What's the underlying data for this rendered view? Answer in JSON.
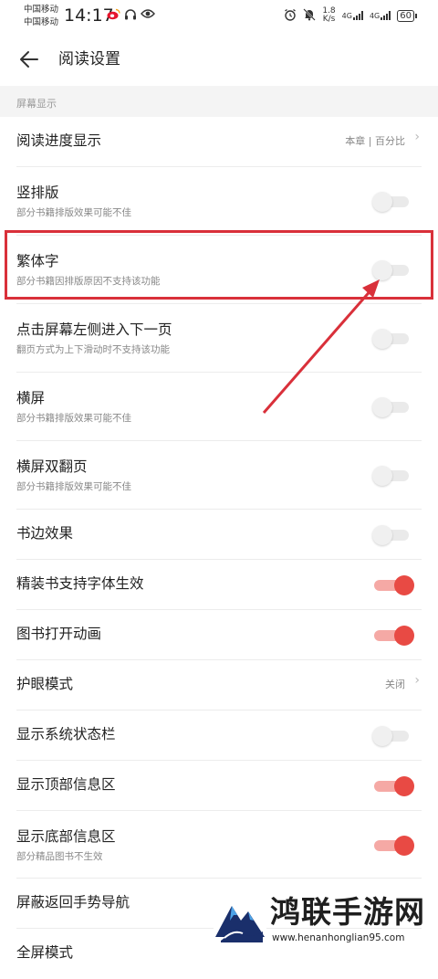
{
  "status_bar": {
    "carrier_1": "中国移动",
    "carrier_2": "中国移动",
    "time": "14:17",
    "net_speed_value": "1.8",
    "net_speed_unit": "K/s",
    "signal_1": "4G",
    "signal_2": "4G",
    "battery": "60"
  },
  "header": {
    "title": "阅读设置"
  },
  "section": {
    "title": "屏幕显示"
  },
  "rows": [
    {
      "title": "阅读进度显示",
      "value": "本章 | 百分比"
    },
    {
      "title": "竖排版",
      "subtitle": "部分书籍排版效果可能不佳",
      "toggle_on": false
    },
    {
      "title": "繁体字",
      "subtitle": "部分书籍因排版原因不支持该功能",
      "toggle_on": false
    },
    {
      "title": "点击屏幕左侧进入下一页",
      "subtitle": "翻页方式为上下滑动时不支持该功能",
      "toggle_on": false
    },
    {
      "title": "横屏",
      "subtitle": "部分书籍排版效果可能不佳",
      "toggle_on": false
    },
    {
      "title": "横屏双翻页",
      "subtitle": "部分书籍排版效果可能不佳",
      "toggle_on": false
    },
    {
      "title": "书边效果",
      "toggle_on": false
    },
    {
      "title": "精装书支持字体生效",
      "toggle_on": true
    },
    {
      "title": "图书打开动画",
      "toggle_on": true
    },
    {
      "title": "护眼模式",
      "value": "关闭"
    },
    {
      "title": "显示系统状态栏",
      "toggle_on": false
    },
    {
      "title": "显示顶部信息区",
      "toggle_on": true
    },
    {
      "title": "显示底部信息区",
      "subtitle": "部分精品图书不生效",
      "toggle_on": true
    },
    {
      "title": "屏蔽返回手势导航"
    },
    {
      "title": "全屏模式"
    }
  ],
  "watermark": {
    "name": "鸿联手游网",
    "url": "www.henanhonglian95.com"
  },
  "colors": {
    "accent": "#e84a44",
    "highlight": "#d9303a"
  }
}
